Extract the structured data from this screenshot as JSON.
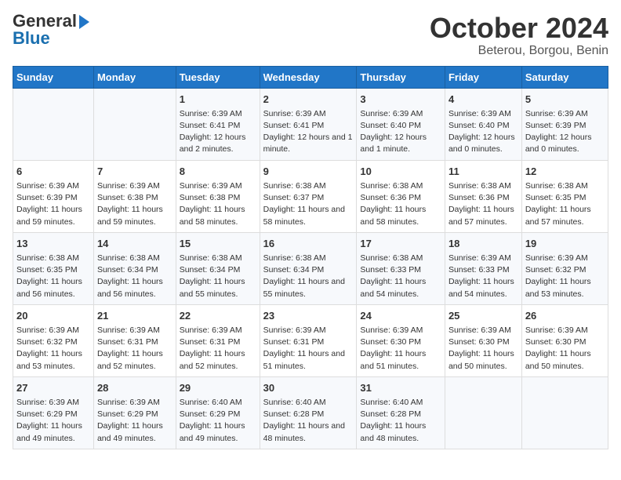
{
  "logo": {
    "general": "General",
    "blue": "Blue"
  },
  "title": {
    "month_year": "October 2024",
    "location": "Beterou, Borgou, Benin"
  },
  "header": {
    "days": [
      "Sunday",
      "Monday",
      "Tuesday",
      "Wednesday",
      "Thursday",
      "Friday",
      "Saturday"
    ]
  },
  "weeks": [
    [
      {
        "day": "",
        "content": ""
      },
      {
        "day": "",
        "content": ""
      },
      {
        "day": "1",
        "content": "Sunrise: 6:39 AM\nSunset: 6:41 PM\nDaylight: 12 hours\nand 2 minutes."
      },
      {
        "day": "2",
        "content": "Sunrise: 6:39 AM\nSunset: 6:41 PM\nDaylight: 12 hours\nand 1 minute."
      },
      {
        "day": "3",
        "content": "Sunrise: 6:39 AM\nSunset: 6:40 PM\nDaylight: 12 hours\nand 1 minute."
      },
      {
        "day": "4",
        "content": "Sunrise: 6:39 AM\nSunset: 6:40 PM\nDaylight: 12 hours\nand 0 minutes."
      },
      {
        "day": "5",
        "content": "Sunrise: 6:39 AM\nSunset: 6:39 PM\nDaylight: 12 hours\nand 0 minutes."
      }
    ],
    [
      {
        "day": "6",
        "content": "Sunrise: 6:39 AM\nSunset: 6:39 PM\nDaylight: 11 hours\nand 59 minutes."
      },
      {
        "day": "7",
        "content": "Sunrise: 6:39 AM\nSunset: 6:38 PM\nDaylight: 11 hours\nand 59 minutes."
      },
      {
        "day": "8",
        "content": "Sunrise: 6:39 AM\nSunset: 6:38 PM\nDaylight: 11 hours\nand 58 minutes."
      },
      {
        "day": "9",
        "content": "Sunrise: 6:38 AM\nSunset: 6:37 PM\nDaylight: 11 hours\nand 58 minutes."
      },
      {
        "day": "10",
        "content": "Sunrise: 6:38 AM\nSunset: 6:36 PM\nDaylight: 11 hours\nand 58 minutes."
      },
      {
        "day": "11",
        "content": "Sunrise: 6:38 AM\nSunset: 6:36 PM\nDaylight: 11 hours\nand 57 minutes."
      },
      {
        "day": "12",
        "content": "Sunrise: 6:38 AM\nSunset: 6:35 PM\nDaylight: 11 hours\nand 57 minutes."
      }
    ],
    [
      {
        "day": "13",
        "content": "Sunrise: 6:38 AM\nSunset: 6:35 PM\nDaylight: 11 hours\nand 56 minutes."
      },
      {
        "day": "14",
        "content": "Sunrise: 6:38 AM\nSunset: 6:34 PM\nDaylight: 11 hours\nand 56 minutes."
      },
      {
        "day": "15",
        "content": "Sunrise: 6:38 AM\nSunset: 6:34 PM\nDaylight: 11 hours\nand 55 minutes."
      },
      {
        "day": "16",
        "content": "Sunrise: 6:38 AM\nSunset: 6:34 PM\nDaylight: 11 hours\nand 55 minutes."
      },
      {
        "day": "17",
        "content": "Sunrise: 6:38 AM\nSunset: 6:33 PM\nDaylight: 11 hours\nand 54 minutes."
      },
      {
        "day": "18",
        "content": "Sunrise: 6:39 AM\nSunset: 6:33 PM\nDaylight: 11 hours\nand 54 minutes."
      },
      {
        "day": "19",
        "content": "Sunrise: 6:39 AM\nSunset: 6:32 PM\nDaylight: 11 hours\nand 53 minutes."
      }
    ],
    [
      {
        "day": "20",
        "content": "Sunrise: 6:39 AM\nSunset: 6:32 PM\nDaylight: 11 hours\nand 53 minutes."
      },
      {
        "day": "21",
        "content": "Sunrise: 6:39 AM\nSunset: 6:31 PM\nDaylight: 11 hours\nand 52 minutes."
      },
      {
        "day": "22",
        "content": "Sunrise: 6:39 AM\nSunset: 6:31 PM\nDaylight: 11 hours\nand 52 minutes."
      },
      {
        "day": "23",
        "content": "Sunrise: 6:39 AM\nSunset: 6:31 PM\nDaylight: 11 hours\nand 51 minutes."
      },
      {
        "day": "24",
        "content": "Sunrise: 6:39 AM\nSunset: 6:30 PM\nDaylight: 11 hours\nand 51 minutes."
      },
      {
        "day": "25",
        "content": "Sunrise: 6:39 AM\nSunset: 6:30 PM\nDaylight: 11 hours\nand 50 minutes."
      },
      {
        "day": "26",
        "content": "Sunrise: 6:39 AM\nSunset: 6:30 PM\nDaylight: 11 hours\nand 50 minutes."
      }
    ],
    [
      {
        "day": "27",
        "content": "Sunrise: 6:39 AM\nSunset: 6:29 PM\nDaylight: 11 hours\nand 49 minutes."
      },
      {
        "day": "28",
        "content": "Sunrise: 6:39 AM\nSunset: 6:29 PM\nDaylight: 11 hours\nand 49 minutes."
      },
      {
        "day": "29",
        "content": "Sunrise: 6:40 AM\nSunset: 6:29 PM\nDaylight: 11 hours\nand 49 minutes."
      },
      {
        "day": "30",
        "content": "Sunrise: 6:40 AM\nSunset: 6:28 PM\nDaylight: 11 hours\nand 48 minutes."
      },
      {
        "day": "31",
        "content": "Sunrise: 6:40 AM\nSunset: 6:28 PM\nDaylight: 11 hours\nand 48 minutes."
      },
      {
        "day": "",
        "content": ""
      },
      {
        "day": "",
        "content": ""
      }
    ]
  ]
}
